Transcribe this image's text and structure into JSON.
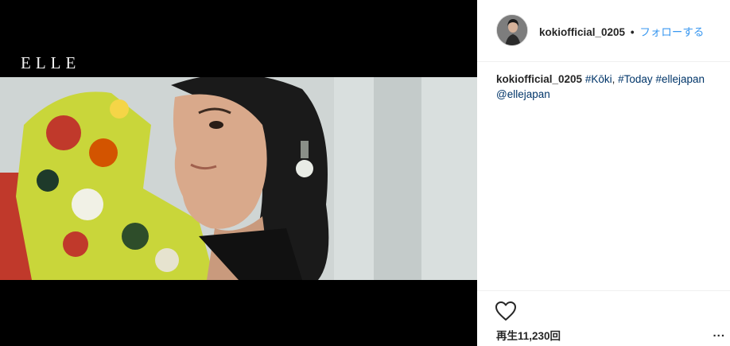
{
  "video": {
    "watermark": "ELLE"
  },
  "post": {
    "username": "kokiofficial_0205",
    "separator": "•",
    "follow_label": "フォローする",
    "caption": {
      "username": "kokiofficial_0205",
      "hashtags": [
        "#Kōki",
        "#Today",
        "#ellejapan"
      ],
      "mention": "@ellejapan"
    },
    "views": "再生11,230回",
    "more_label": "..."
  },
  "colors": {
    "link_blue": "#3897f0",
    "hashtag_blue": "#003569",
    "text": "#262626",
    "divider": "#efefef"
  },
  "icons": {
    "like": "heart-outline-icon",
    "more": "more-options-icon"
  }
}
